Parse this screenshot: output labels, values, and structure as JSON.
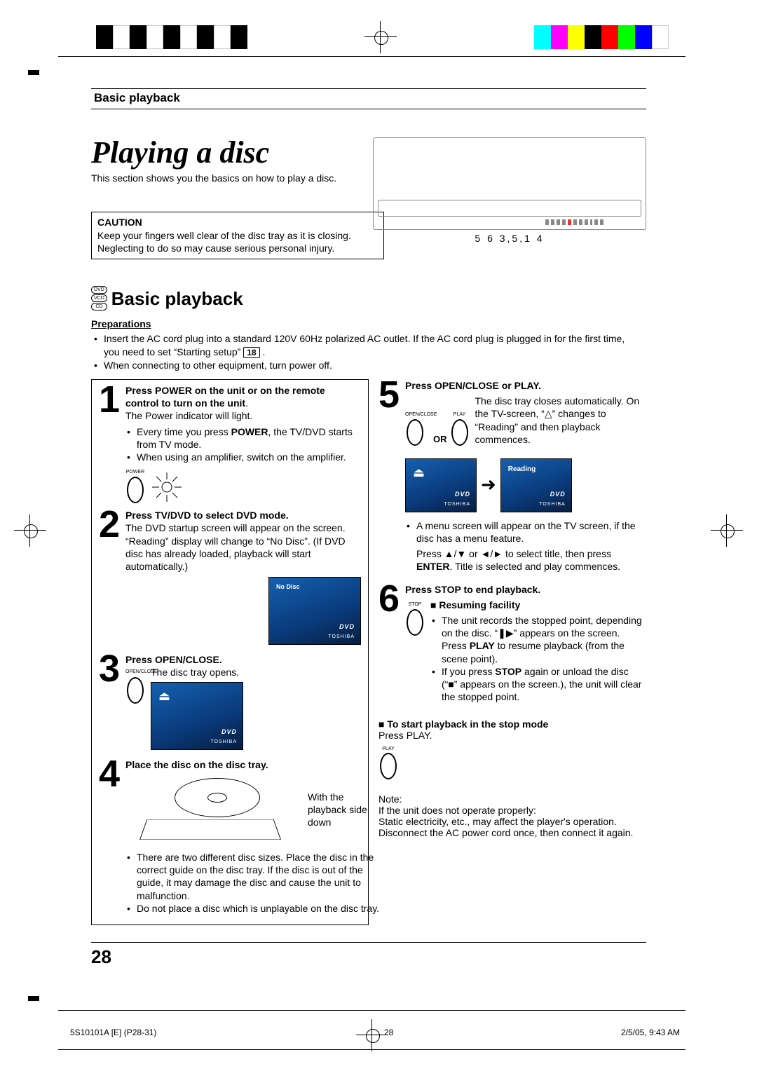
{
  "header": {
    "section": "Basic playback"
  },
  "chapter": {
    "title": "Playing a disc",
    "intro": "This section shows you the basics on how to play a disc."
  },
  "caution": {
    "heading": "CAUTION",
    "text": "Keep your fingers well clear of the disc tray as it is closing. Neglecting to do so may cause serious personal injury."
  },
  "device_numbers": "5  6  3,5,1  4",
  "section": {
    "badges": {
      "dvd": "DVD",
      "vcd": "VCD",
      "cd": "CD"
    },
    "title": "Basic playback"
  },
  "prep": {
    "heading": "Preparations",
    "item1a": "Insert the AC cord plug into a standard 120V 60Hz polarized AC outlet. If the AC cord plug is plugged in for the first time,",
    "item1b": "you need to set “Starting setup” ",
    "page_ref": "18",
    "period": ".",
    "item2": "When connecting to other equipment, turn power off."
  },
  "steps": {
    "s1": {
      "title_a": "Press POWER on the unit or on the remote control to turn on the unit",
      "after_title": ".",
      "line1": "The Power indicator will light.",
      "bul1a": "Every time you press ",
      "bul1b": "POWER",
      "bul1c": ", the TV/DVD starts from TV mode.",
      "bul2": "When using an amplifier, switch on the amplifier.",
      "btn": "POWER"
    },
    "s2": {
      "title": "Press TV/DVD to select DVD mode.",
      "body": "The DVD startup screen will appear on the screen. “Reading” display will change to “No Disc”. (If DVD disc has already loaded, playback will start automatically.)",
      "thumb_label": "No Disc",
      "thumb_dvd": "DVD",
      "thumb_brand": "TOSHIBA"
    },
    "s3": {
      "title": "Press OPEN/CLOSE.",
      "body": "The disc tray opens.",
      "btn": "OPEN/CLOSE"
    },
    "s4": {
      "title": "Place the disc on the disc tray.",
      "side_note": "With the playback side down",
      "bul1": "There are two different disc sizes. Place the disc in the correct guide on the disc tray. If the disc is out of the guide, it may damage the disc and cause the unit to malfunction.",
      "bul2": "Do not place a disc which is unplayable on the disc tray."
    },
    "s5": {
      "title": "Press OPEN/CLOSE or PLAY.",
      "body1": "The disc tray closes automatically. On the TV-screen, “△” changes to “Reading” and then playback commences.",
      "btn1": "OPEN/CLOSE",
      "or": "OR",
      "btn2": "PLAY",
      "reading": "Reading",
      "after1": "A menu screen will appear on the TV screen, if the disc has a menu feature.",
      "after2a": "Press ▲/▼ or ◄/► to select title, then press ",
      "after2b": "ENTER",
      "after2c": ". Title is selected and play commences."
    },
    "s6": {
      "title": "Press STOP to end playback.",
      "btn": "STOP",
      "resume_head": "■ Resuming facility",
      "resume_b1a": "The unit records the stopped point, depending on the disc. “❚▶” appears on the screen. Press ",
      "resume_b1b": "PLAY",
      "resume_b1c": " to resume playback (from the scene point).",
      "resume_b2a": "If you press ",
      "resume_b2b": "STOP",
      "resume_b2c": " again or unload the disc (“■” appears on the screen.), the unit will clear the stopped point."
    }
  },
  "start_stop": {
    "head": "■ To start playback in the stop mode",
    "body_a": "Press ",
    "body_b": "PLAY",
    "body_c": ".",
    "btn": "PLAY"
  },
  "note": {
    "label": "Note:",
    "head": "If the unit does not operate properly:",
    "body": "Static electricity, etc., may affect the player's operation. Disconnect the AC power cord once, then connect it again."
  },
  "page_number": "28",
  "footer": {
    "doc": "5S10101A [E] (P28-31)",
    "idx": "28",
    "date": "2/5/05, 9:43 AM"
  },
  "thumb_dvd": "DVD",
  "thumb_brand": "TOSHIBA"
}
